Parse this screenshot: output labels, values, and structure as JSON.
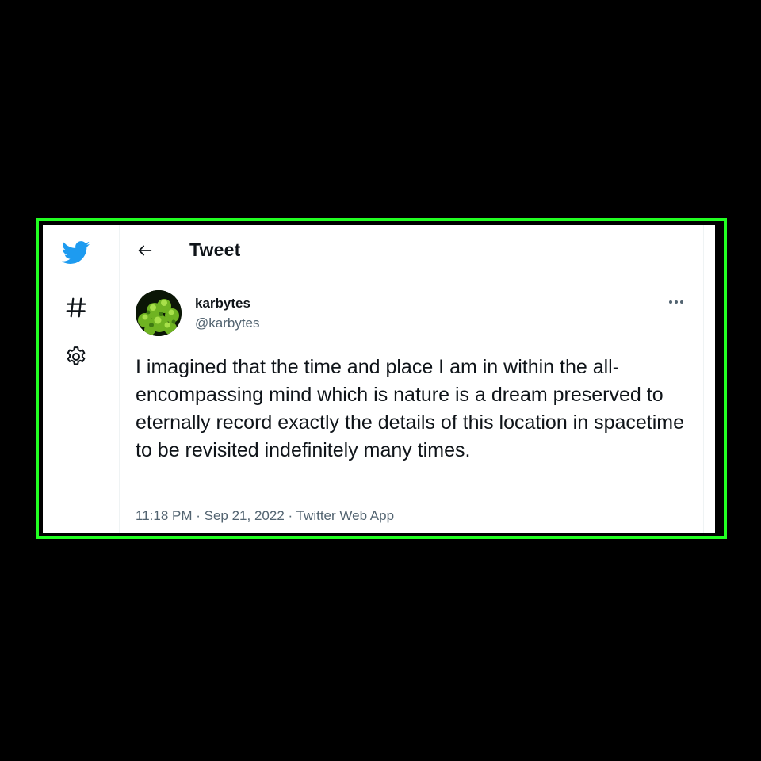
{
  "colors": {
    "page_background": "#000000",
    "frame_border": "#22ff22",
    "twitter_blue": "#1d9bf0",
    "text_primary": "#0f1419",
    "text_secondary": "#536471",
    "panel_background": "#ffffff"
  },
  "sidebar": {
    "items": [
      {
        "icon": "twitter-bird-icon"
      },
      {
        "icon": "hashtag-explore-icon"
      },
      {
        "icon": "settings-gear-icon"
      }
    ]
  },
  "header": {
    "back_icon": "back-arrow-icon",
    "title": "Tweet"
  },
  "tweet": {
    "author": {
      "display_name": "karbytes",
      "handle": "@karbytes",
      "avatar_icon": "green-moss-avatar"
    },
    "more_icon": "more-options-icon",
    "text": "I imagined that the time and place I am in within the all-encompassing mind which is nature is a dream preserved to eternally record exactly the details of this location in spacetime to be revisited indefinitely many times.",
    "time": "11:18 PM",
    "separator": " · ",
    "date": "Sep 21, 2022",
    "source": "Twitter Web App"
  }
}
